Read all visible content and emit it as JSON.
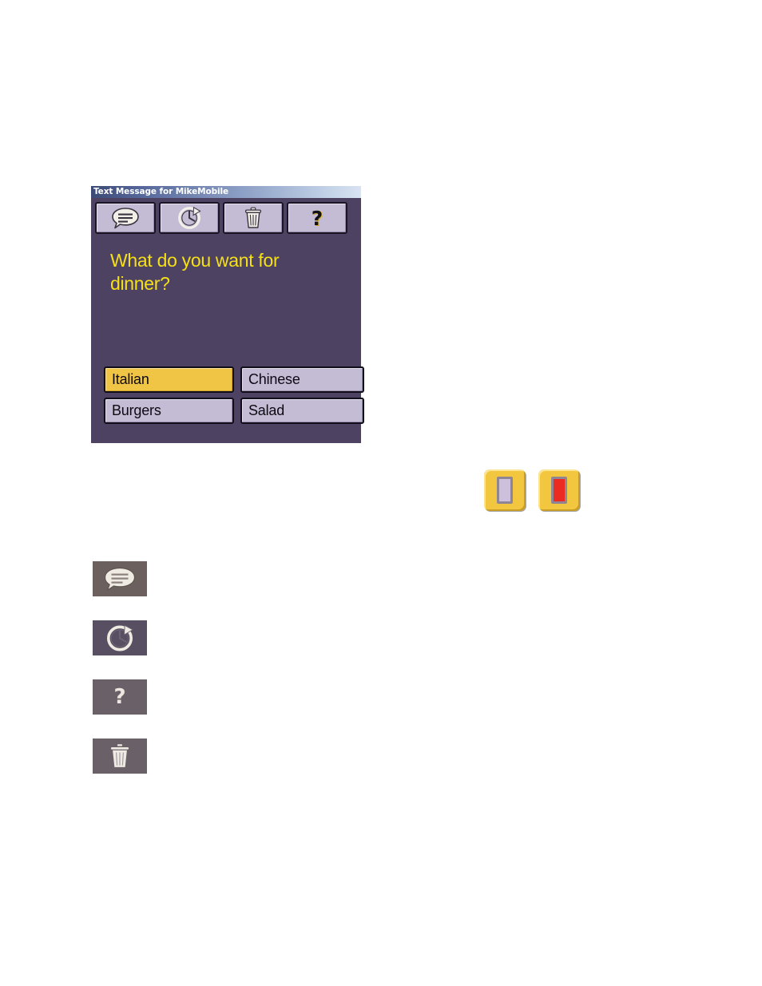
{
  "page": {
    "background_color": "#ffffff"
  },
  "device_window": {
    "title": "Text Message for MikeMobile",
    "screen_background_color": "#4e4263",
    "toolbar": {
      "buttons": [
        {
          "name": "message-button",
          "icon": "speech-bubble-icon",
          "label": ""
        },
        {
          "name": "history-button",
          "icon": "clock-arrow-icon",
          "label": ""
        },
        {
          "name": "delete-button",
          "icon": "trash-can-icon",
          "label": ""
        },
        {
          "name": "help-button",
          "icon": "question-mark-icon",
          "label": "?"
        }
      ]
    },
    "message": {
      "text": "What do you want for dinner?",
      "text_color": "#f5e016"
    },
    "answers": [
      {
        "label": "Italian",
        "selected": true
      },
      {
        "label": "Chinese",
        "selected": false
      },
      {
        "label": "Burgers",
        "selected": false
      },
      {
        "label": "Salad",
        "selected": false
      }
    ],
    "answer_selected_color": "#f0c444",
    "answer_default_color": "#c4bbd4"
  },
  "indicators": [
    {
      "name": "indicator-inactive",
      "icon": "indicator-bar-icon",
      "bar_color": "#cdc0dc",
      "state": "inactive"
    },
    {
      "name": "indicator-active",
      "icon": "indicator-bar-icon",
      "bar_color": "#ed2a22",
      "state": "active"
    }
  ],
  "legend": [
    {
      "name": "legend-message",
      "icon": "speech-bubble-icon",
      "tile_color": "#6b605d"
    },
    {
      "name": "legend-history",
      "icon": "clock-arrow-icon",
      "tile_color": "#584f62"
    },
    {
      "name": "legend-help",
      "icon": "question-mark-icon",
      "glyph": "?",
      "tile_color": "#6a6068"
    },
    {
      "name": "legend-delete",
      "icon": "trash-can-icon",
      "tile_color": "#6a6068"
    }
  ]
}
